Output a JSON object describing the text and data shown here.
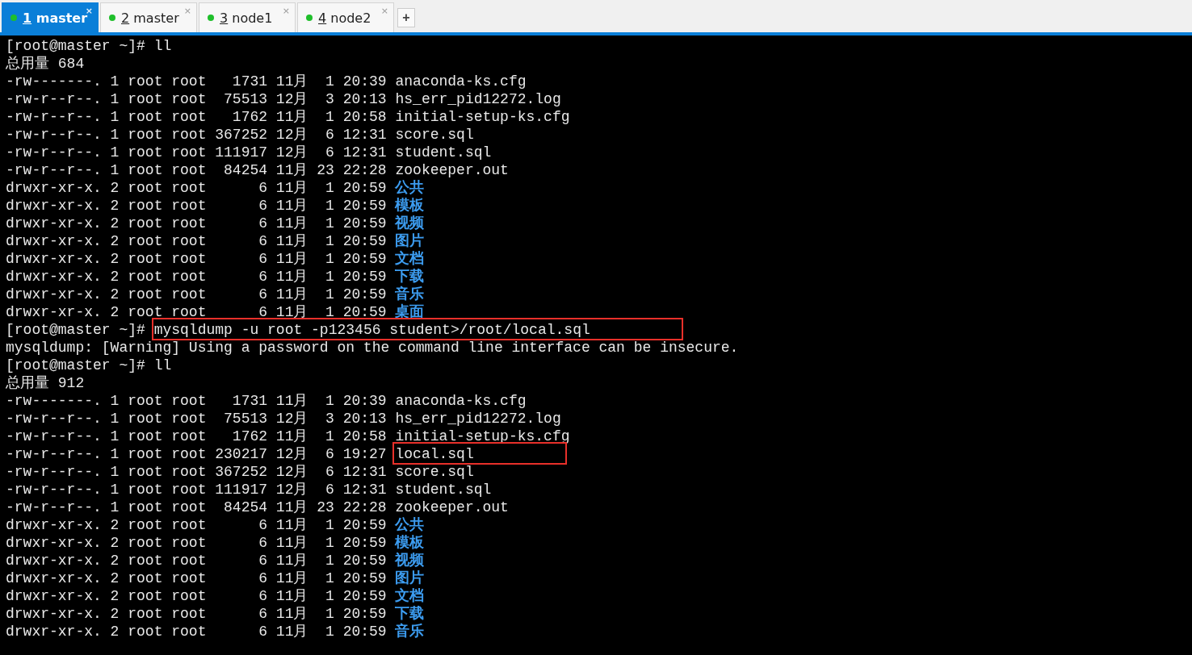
{
  "tabs": [
    {
      "number": "1",
      "label": "master",
      "selected": true,
      "close": "×"
    },
    {
      "number": "2",
      "label": "master",
      "selected": false,
      "close": "×"
    },
    {
      "number": "3",
      "label": "node1",
      "selected": false,
      "close": "×"
    },
    {
      "number": "4",
      "label": "node2",
      "selected": false,
      "close": "×"
    }
  ],
  "new_tab": "+",
  "terminal": [
    {
      "segments": [
        {
          "text": "[root@master ~]# ll",
          "kind": "plain"
        }
      ]
    },
    {
      "segments": [
        {
          "text": "总用量 684",
          "kind": "plain"
        }
      ]
    },
    {
      "segments": [
        {
          "text": "-rw-------. 1 root root   1731 11月  1 20:39 ",
          "kind": "plain"
        },
        {
          "text": "anaconda-ks.cfg",
          "kind": "plain"
        }
      ]
    },
    {
      "segments": [
        {
          "text": "-rw-r--r--. 1 root root  75513 12月  3 20:13 ",
          "kind": "plain"
        },
        {
          "text": "hs_err_pid12272.log",
          "kind": "plain"
        }
      ]
    },
    {
      "segments": [
        {
          "text": "-rw-r--r--. 1 root root   1762 11月  1 20:58 ",
          "kind": "plain"
        },
        {
          "text": "initial-setup-ks.cfg",
          "kind": "plain"
        }
      ]
    },
    {
      "segments": [
        {
          "text": "-rw-r--r--. 1 root root 367252 12月  6 12:31 ",
          "kind": "plain"
        },
        {
          "text": "score.sql",
          "kind": "plain"
        }
      ]
    },
    {
      "segments": [
        {
          "text": "-rw-r--r--. 1 root root 111917 12月  6 12:31 ",
          "kind": "plain"
        },
        {
          "text": "student.sql",
          "kind": "plain"
        }
      ]
    },
    {
      "segments": [
        {
          "text": "-rw-r--r--. 1 root root  84254 11月 23 22:28 ",
          "kind": "plain"
        },
        {
          "text": "zookeeper.out",
          "kind": "plain"
        }
      ]
    },
    {
      "segments": [
        {
          "text": "drwxr-xr-x. 2 root root      6 11月  1 20:59 ",
          "kind": "plain"
        },
        {
          "text": "公共",
          "kind": "dir"
        }
      ]
    },
    {
      "segments": [
        {
          "text": "drwxr-xr-x. 2 root root      6 11月  1 20:59 ",
          "kind": "plain"
        },
        {
          "text": "模板",
          "kind": "dir"
        }
      ]
    },
    {
      "segments": [
        {
          "text": "drwxr-xr-x. 2 root root      6 11月  1 20:59 ",
          "kind": "plain"
        },
        {
          "text": "视频",
          "kind": "dir"
        }
      ]
    },
    {
      "segments": [
        {
          "text": "drwxr-xr-x. 2 root root      6 11月  1 20:59 ",
          "kind": "plain"
        },
        {
          "text": "图片",
          "kind": "dir"
        }
      ]
    },
    {
      "segments": [
        {
          "text": "drwxr-xr-x. 2 root root      6 11月  1 20:59 ",
          "kind": "plain"
        },
        {
          "text": "文档",
          "kind": "dir"
        }
      ]
    },
    {
      "segments": [
        {
          "text": "drwxr-xr-x. 2 root root      6 11月  1 20:59 ",
          "kind": "plain"
        },
        {
          "text": "下载",
          "kind": "dir"
        }
      ]
    },
    {
      "segments": [
        {
          "text": "drwxr-xr-x. 2 root root      6 11月  1 20:59 ",
          "kind": "plain"
        },
        {
          "text": "音乐",
          "kind": "dir"
        }
      ]
    },
    {
      "segments": [
        {
          "text": "drwxr-xr-x. 2 root root      6 11月  1 20:59 ",
          "kind": "plain"
        },
        {
          "text": "桌面",
          "kind": "dir"
        }
      ]
    },
    {
      "segments": [
        {
          "text": "[root@master ~]# ",
          "kind": "plain"
        },
        {
          "text": "mysqldump -u root -p123456 student>/root/local.sql",
          "kind": "marked"
        }
      ]
    },
    {
      "segments": [
        {
          "text": "mysqldump: [Warning] Using a password on the command line interface can be insecure.",
          "kind": "plain"
        }
      ]
    },
    {
      "segments": [
        {
          "text": "[root@master ~]# ll",
          "kind": "plain"
        }
      ]
    },
    {
      "segments": [
        {
          "text": "总用量 912",
          "kind": "plain"
        }
      ]
    },
    {
      "segments": [
        {
          "text": "-rw-------. 1 root root   1731 11月  1 20:39 ",
          "kind": "plain"
        },
        {
          "text": "anaconda-ks.cfg",
          "kind": "plain"
        }
      ]
    },
    {
      "segments": [
        {
          "text": "-rw-r--r--. 1 root root  75513 12月  3 20:13 ",
          "kind": "plain"
        },
        {
          "text": "hs_err_pid12272.log",
          "kind": "plain"
        }
      ]
    },
    {
      "segments": [
        {
          "text": "-rw-r--r--. 1 root root   1762 11月  1 20:58 ",
          "kind": "plain"
        },
        {
          "text": "initial-setup-ks.cfg",
          "kind": "plain"
        }
      ]
    },
    {
      "segments": [
        {
          "text": "-rw-r--r--. 1 root root 230217 12月  6 19:27 ",
          "kind": "plain"
        },
        {
          "text": "local.sql",
          "kind": "marked"
        }
      ]
    },
    {
      "segments": [
        {
          "text": "-rw-r--r--. 1 root root 367252 12月  6 12:31 ",
          "kind": "plain"
        },
        {
          "text": "score.sql",
          "kind": "plain"
        }
      ]
    },
    {
      "segments": [
        {
          "text": "-rw-r--r--. 1 root root 111917 12月  6 12:31 ",
          "kind": "plain"
        },
        {
          "text": "student.sql",
          "kind": "plain"
        }
      ]
    },
    {
      "segments": [
        {
          "text": "-rw-r--r--. 1 root root  84254 11月 23 22:28 ",
          "kind": "plain"
        },
        {
          "text": "zookeeper.out",
          "kind": "plain"
        }
      ]
    },
    {
      "segments": [
        {
          "text": "drwxr-xr-x. 2 root root      6 11月  1 20:59 ",
          "kind": "plain"
        },
        {
          "text": "公共",
          "kind": "dir"
        }
      ]
    },
    {
      "segments": [
        {
          "text": "drwxr-xr-x. 2 root root      6 11月  1 20:59 ",
          "kind": "plain"
        },
        {
          "text": "模板",
          "kind": "dir"
        }
      ]
    },
    {
      "segments": [
        {
          "text": "drwxr-xr-x. 2 root root      6 11月  1 20:59 ",
          "kind": "plain"
        },
        {
          "text": "视频",
          "kind": "dir"
        }
      ]
    },
    {
      "segments": [
        {
          "text": "drwxr-xr-x. 2 root root      6 11月  1 20:59 ",
          "kind": "plain"
        },
        {
          "text": "图片",
          "kind": "dir"
        }
      ]
    },
    {
      "segments": [
        {
          "text": "drwxr-xr-x. 2 root root      6 11月  1 20:59 ",
          "kind": "plain"
        },
        {
          "text": "文档",
          "kind": "dir"
        }
      ]
    },
    {
      "segments": [
        {
          "text": "drwxr-xr-x. 2 root root      6 11月  1 20:59 ",
          "kind": "plain"
        },
        {
          "text": "下载",
          "kind": "dir"
        }
      ]
    },
    {
      "segments": [
        {
          "text": "drwxr-xr-x. 2 root root      6 11月  1 20:59 ",
          "kind": "plain"
        },
        {
          "text": "音乐",
          "kind": "dir"
        }
      ]
    }
  ]
}
